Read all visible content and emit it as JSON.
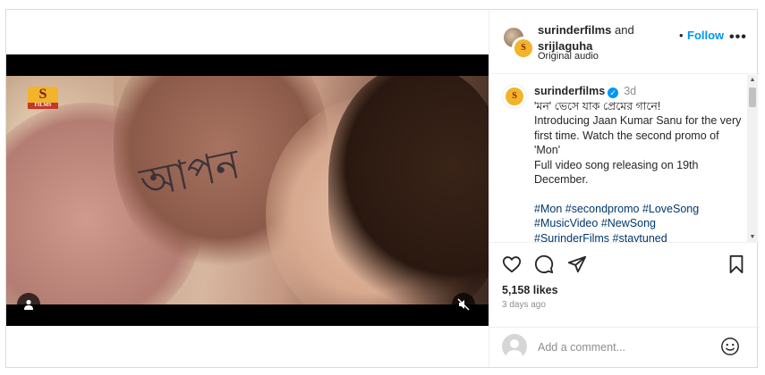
{
  "post": {
    "brand_logo_text": "S",
    "brand_logo_sub": "FILMS",
    "tattoo_glyphs": "আপন",
    "header": {
      "user1": "surinderfilms",
      "connector": "and",
      "user2": "srijlaguha",
      "dot": "•",
      "follow_label": "Follow",
      "more_label": "•••",
      "audio": "Original audio"
    },
    "caption": {
      "username": "surinderfilms",
      "verified_mark": "✓",
      "time": "3d",
      "lines": [
        "'মন' ভেসে যাক প্রেমের গানে!",
        "Introducing Jaan Kumar Sanu for the very first time. Watch the second promo of 'Mon'",
        "Full video song releasing on 19th December."
      ],
      "hashtags": [
        "#Mon",
        "#secondpromo",
        "#LoveSong",
        "#MusicVideo",
        "#NewSong",
        "#SurinderFilms",
        "#staytuned"
      ]
    },
    "likes": "5,158 likes",
    "time_ago": "3 days ago",
    "comment": {
      "placeholder": "Add a comment..."
    },
    "icons": {
      "like": "heart-icon",
      "comment": "comment-icon",
      "share": "share-icon",
      "save": "bookmark-icon",
      "user": "user-icon",
      "mute": "mute-icon",
      "emoji": "emoji-icon"
    },
    "colors": {
      "link_blue": "#0095f6",
      "hashtag_blue": "#00376b",
      "text": "#262626",
      "muted": "#8e8e8e"
    }
  }
}
